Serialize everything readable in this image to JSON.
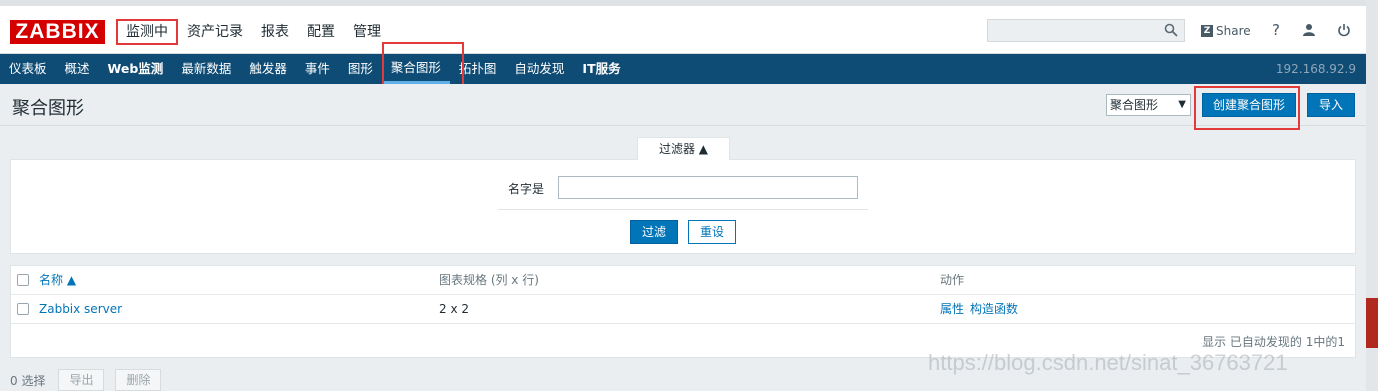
{
  "brand": {
    "logo_text": "ZABBIX",
    "accent": "#d40000"
  },
  "main_menu": [
    {
      "label": "监测中",
      "active": true
    },
    {
      "label": "资产记录"
    },
    {
      "label": "报表"
    },
    {
      "label": "配置"
    },
    {
      "label": "管理"
    }
  ],
  "header": {
    "search_placeholder": "",
    "share_label": "Share",
    "help_icon": "question-icon",
    "user_icon": "user-icon",
    "logout_icon": "power-icon"
  },
  "sub_menu": [
    {
      "label": "仪表板"
    },
    {
      "label": "概述"
    },
    {
      "label": "Web监测",
      "bold": true
    },
    {
      "label": "最新数据"
    },
    {
      "label": "触发器"
    },
    {
      "label": "事件"
    },
    {
      "label": "图形"
    },
    {
      "label": "聚合图形",
      "active": true
    },
    {
      "label": "拓扑图"
    },
    {
      "label": "自动发现"
    },
    {
      "label": "IT服务",
      "bold": true
    }
  ],
  "server_ip": "192.168.92.9",
  "page": {
    "title": "聚合图形",
    "view_select": "聚合图形",
    "create_button": "创建聚合图形",
    "import_button": "导入"
  },
  "filter": {
    "tab_label": "过滤器 ▲",
    "name_label": "名字是",
    "name_value": "",
    "apply_button": "过滤",
    "reset_button": "重设"
  },
  "table": {
    "columns": {
      "name": "名称 ▲",
      "size": "图表规格 (列 x 行)",
      "actions": "动作"
    },
    "rows": [
      {
        "name": "Zabbix server",
        "size": "2 x 2",
        "action_properties": "属性",
        "action_constructor": "构造函数"
      }
    ],
    "footer": "显示 已自动发现的 1中的1"
  },
  "bulk_actions": {
    "selected": "0 选择",
    "export": "导出",
    "delete": "删除"
  },
  "watermark": "https://blog.csdn.net/sinat_36763721"
}
